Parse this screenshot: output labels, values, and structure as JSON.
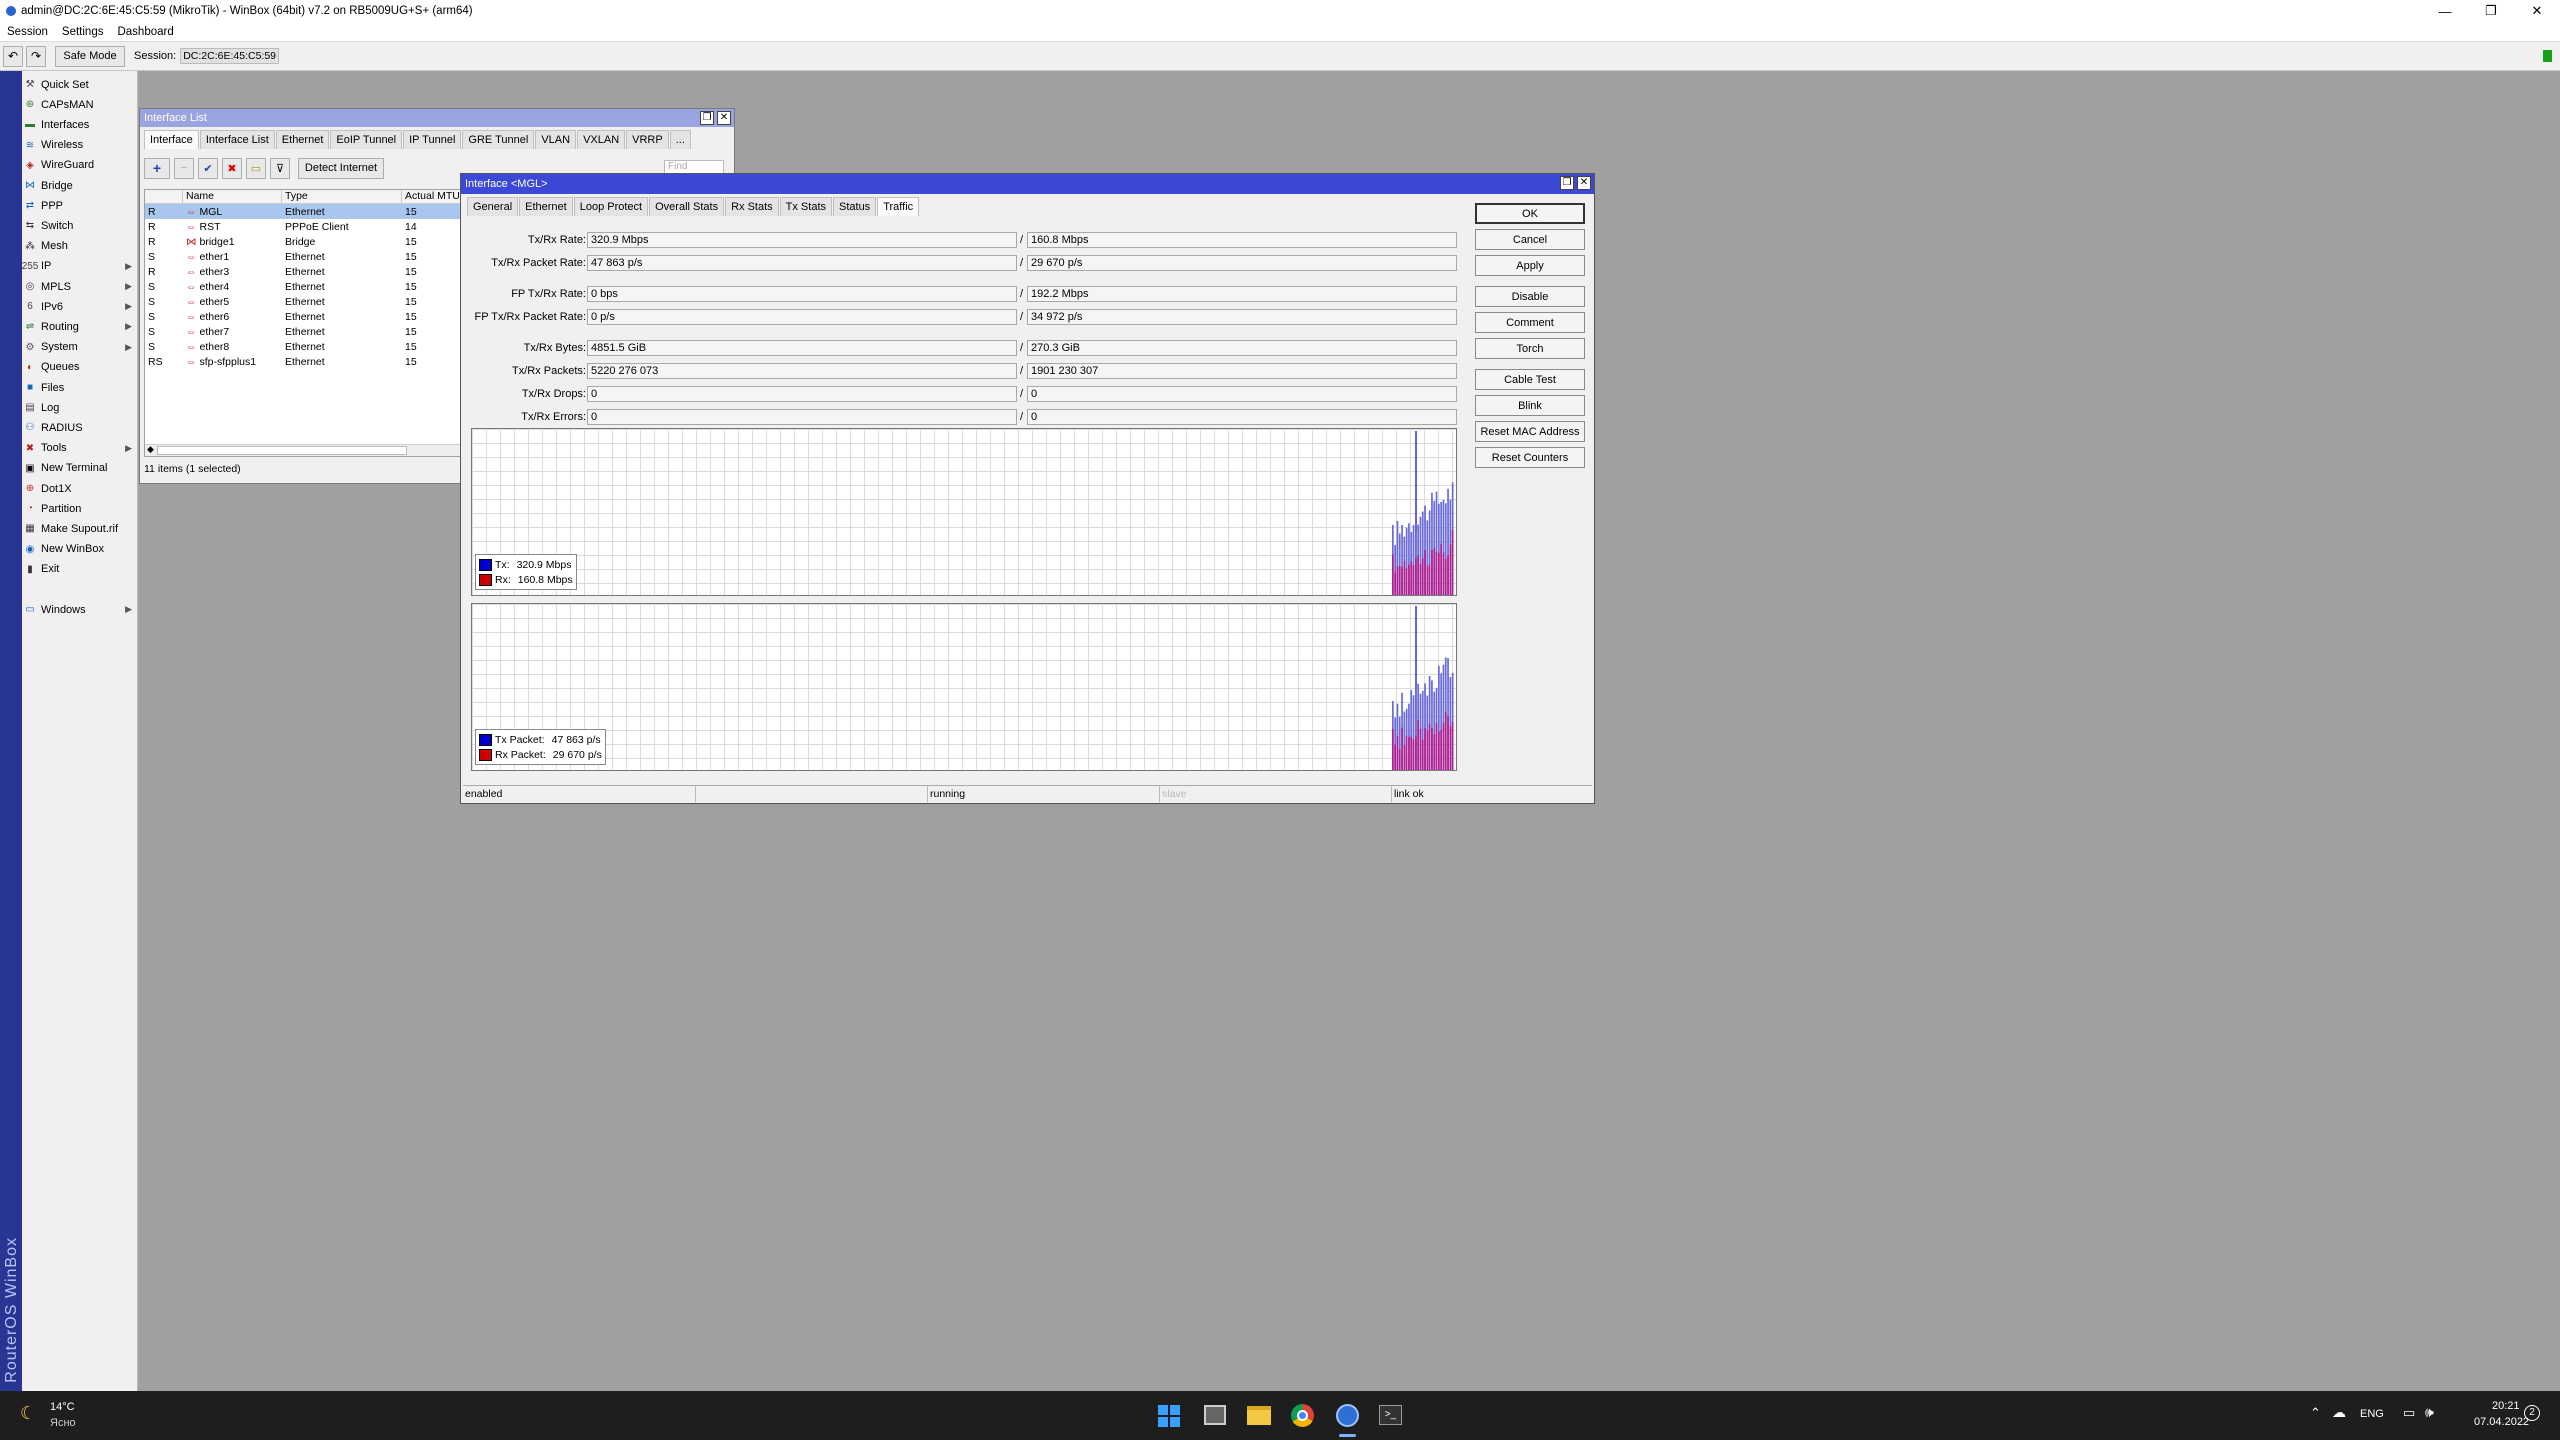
{
  "window": {
    "title": "admin@DC:2C:6E:45:C5:59 (MikroTik) - WinBox (64bit) v7.2 on RB5009UG+S+ (arm64)",
    "controls": [
      "—",
      "❐",
      "✕"
    ]
  },
  "menu": [
    "Session",
    "Settings",
    "Dashboard"
  ],
  "toolbar": {
    "undo": "↶",
    "redo": "↷",
    "safe_mode": "Safe Mode",
    "session_label": "Session:",
    "session_value": "DC:2C:6E:45:C5:59"
  },
  "brand_vertical": "RouterOS WinBox",
  "sidebar": [
    {
      "label": "Quick Set",
      "icon": "⚒",
      "color": "#444",
      "submenu": false
    },
    {
      "label": "CAPsMAN",
      "icon": "⊛",
      "color": "#2e7d32",
      "submenu": false
    },
    {
      "label": "Interfaces",
      "icon": "▬",
      "color": "#2e7d32",
      "submenu": false
    },
    {
      "label": "Wireless",
      "icon": "≋",
      "color": "#1565c0",
      "submenu": false
    },
    {
      "label": "WireGuard",
      "icon": "◈",
      "color": "#b71c1c",
      "submenu": false
    },
    {
      "label": "Bridge",
      "icon": "⋈",
      "color": "#1565c0",
      "submenu": false
    },
    {
      "label": "PPP",
      "icon": "⇄",
      "color": "#1565c0",
      "submenu": false
    },
    {
      "label": "Switch",
      "icon": "⇆",
      "color": "#333",
      "submenu": false
    },
    {
      "label": "Mesh",
      "icon": "⁂",
      "color": "#333",
      "submenu": false
    },
    {
      "label": "IP",
      "icon": "255",
      "color": "#444",
      "submenu": true
    },
    {
      "label": "MPLS",
      "icon": "◎",
      "color": "#444",
      "submenu": true
    },
    {
      "label": "IPv6",
      "icon": "6",
      "color": "#444",
      "submenu": true
    },
    {
      "label": "Routing",
      "icon": "⇌",
      "color": "#2e7d32",
      "submenu": true
    },
    {
      "label": "System",
      "icon": "⚙",
      "color": "#555",
      "submenu": true
    },
    {
      "label": "Queues",
      "icon": "◐",
      "color": "#c62828",
      "submenu": false
    },
    {
      "label": "Files",
      "icon": "■",
      "color": "#1565c0",
      "submenu": false
    },
    {
      "label": "Log",
      "icon": "▤",
      "color": "#444",
      "submenu": false
    },
    {
      "label": "RADIUS",
      "icon": "⚇",
      "color": "#1565c0",
      "submenu": false
    },
    {
      "label": "Tools",
      "icon": "✖",
      "color": "#b71c1c",
      "submenu": true
    },
    {
      "label": "New Terminal",
      "icon": "▣",
      "color": "#000",
      "submenu": false
    },
    {
      "label": "Dot1X",
      "icon": "⊕",
      "color": "#c62828",
      "submenu": false
    },
    {
      "label": "Partition",
      "icon": "◔",
      "color": "#c62828",
      "submenu": false
    },
    {
      "label": "Make Supout.rif",
      "icon": "▦",
      "color": "#333",
      "submenu": false
    },
    {
      "label": "New WinBox",
      "icon": "◉",
      "color": "#1565c0",
      "submenu": false
    },
    {
      "label": "Exit",
      "icon": "▮",
      "color": "#333",
      "submenu": false
    },
    {
      "label": "Windows",
      "icon": "▭",
      "color": "#1565c0",
      "submenu": true
    }
  ],
  "iface_list": {
    "title": "Interface List",
    "tabs": [
      "Interface",
      "Interface List",
      "Ethernet",
      "EoIP Tunnel",
      "IP Tunnel",
      "GRE Tunnel",
      "VLAN",
      "VXLAN",
      "VRRP",
      "..."
    ],
    "toolbar": {
      "add": "+",
      "remove": "−",
      "enable": "✔",
      "disable": "✖",
      "comment": "▭",
      "filter": "⊽",
      "detect": "Detect Internet",
      "find": "Find"
    },
    "columns": [
      "",
      "Name",
      "Type",
      "Actual MTU"
    ],
    "rows": [
      {
        "flag": "R",
        "name": "MGL",
        "type": "Ethernet",
        "mtu": "15",
        "icon": "⇔"
      },
      {
        "flag": "R",
        "name": "RST",
        "type": "PPPoE Client",
        "mtu": "14",
        "icon": "⇔"
      },
      {
        "flag": "R",
        "name": "bridge1",
        "type": "Bridge",
        "mtu": "15",
        "icon": "⋈"
      },
      {
        "flag": "S",
        "name": "ether1",
        "type": "Ethernet",
        "mtu": "15",
        "icon": "⇔"
      },
      {
        "flag": "R",
        "name": "ether3",
        "type": "Ethernet",
        "mtu": "15",
        "icon": "⇔"
      },
      {
        "flag": "S",
        "name": "ether4",
        "type": "Ethernet",
        "mtu": "15",
        "icon": "⇔"
      },
      {
        "flag": "S",
        "name": "ether5",
        "type": "Ethernet",
        "mtu": "15",
        "icon": "⇔"
      },
      {
        "flag": "S",
        "name": "ether6",
        "type": "Ethernet",
        "mtu": "15",
        "icon": "⇔"
      },
      {
        "flag": "S",
        "name": "ether7",
        "type": "Ethernet",
        "mtu": "15",
        "icon": "⇔"
      },
      {
        "flag": "S",
        "name": "ether8",
        "type": "Ethernet",
        "mtu": "15",
        "icon": "⇔"
      },
      {
        "flag": "RS",
        "name": "sfp-sfpplus1",
        "type": "Ethernet",
        "mtu": "15",
        "icon": "⇔"
      }
    ],
    "status": "11 items (1 selected)"
  },
  "iface_dialog": {
    "title": "Interface <MGL>",
    "tabs": [
      "General",
      "Ethernet",
      "Loop Protect",
      "Overall Stats",
      "Rx Stats",
      "Tx Stats",
      "Status",
      "Traffic"
    ],
    "active_tab": "Traffic",
    "fields": [
      {
        "label": "Tx/Rx Rate:",
        "tx": "320.9 Mbps",
        "rx": "160.8 Mbps"
      },
      {
        "label": "Tx/Rx Packet Rate:",
        "tx": "47 863 p/s",
        "rx": "29 670 p/s"
      },
      {
        "label": "FP Tx/Rx Rate:",
        "tx": "0 bps",
        "rx": "192.2 Mbps"
      },
      {
        "label": "FP Tx/Rx Packet Rate:",
        "tx": "0 p/s",
        "rx": "34 972 p/s"
      },
      {
        "label": "Tx/Rx Bytes:",
        "tx": "4851.5 GiB",
        "rx": "270.3 GiB"
      },
      {
        "label": "Tx/Rx Packets:",
        "tx": "5220 276 073",
        "rx": "1901 230 307"
      },
      {
        "label": "Tx/Rx Drops:",
        "tx": "0",
        "rx": "0"
      },
      {
        "label": "Tx/Rx Errors:",
        "tx": "0",
        "rx": "0"
      }
    ],
    "separator": "/",
    "buttons": [
      "OK",
      "Cancel",
      "Apply",
      "Disable",
      "Comment",
      "Torch",
      "Cable Test",
      "Blink",
      "Reset MAC Address",
      "Reset Counters"
    ],
    "graph1_legend": [
      {
        "label": "Tx:",
        "value": "320.9 Mbps",
        "color": "#0000cc"
      },
      {
        "label": "Rx:",
        "value": "160.8 Mbps",
        "color": "#cc0000"
      }
    ],
    "graph2_legend": [
      {
        "label": "Tx Packet:",
        "value": "47 863 p/s",
        "color": "#0000cc"
      },
      {
        "label": "Rx Packet:",
        "value": "29 670 p/s",
        "color": "#cc0000"
      }
    ],
    "status": [
      "enabled",
      "running",
      "slave",
      "link ok"
    ]
  },
  "taskbar": {
    "weather_temp": "14°C",
    "weather_desc": "Ясно",
    "lang": "ENG",
    "time": "20:21",
    "date": "07.04.2022",
    "notif_count": "2"
  },
  "colors": {
    "tx": "#0000cc",
    "rx": "#cc0000",
    "dialog_title": "#3b49d6",
    "list_title": "#9aa4e0"
  }
}
